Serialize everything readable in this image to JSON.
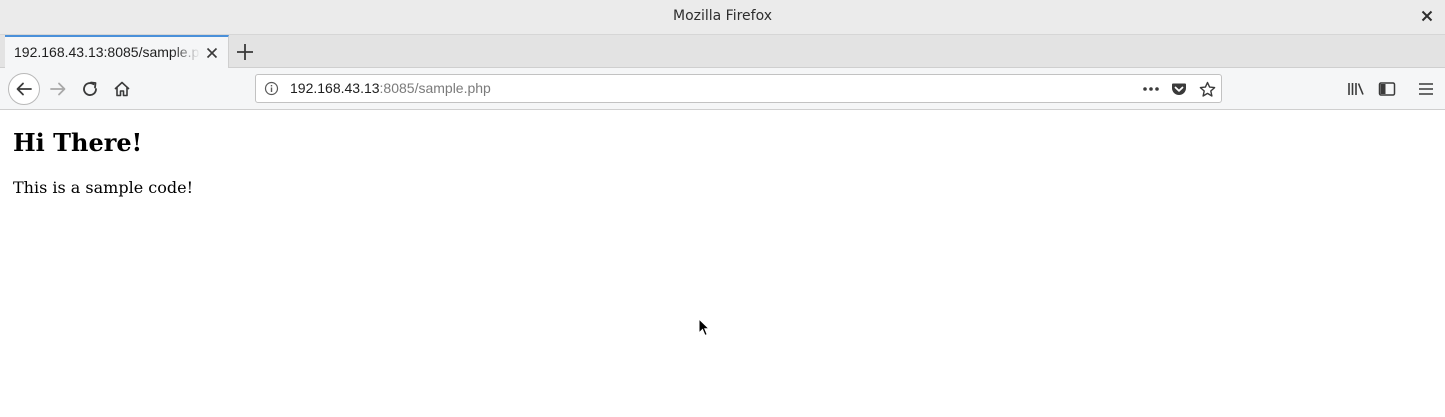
{
  "window": {
    "title": "Mozilla Firefox"
  },
  "tabs": [
    {
      "title": "192.168.43.13:8085/sample.php",
      "active": true
    }
  ],
  "urlbar": {
    "host": "192.168.43.13",
    "rest": ":8085/sample.php"
  },
  "page": {
    "heading": "Hi There!",
    "paragraph": "This is a sample code!"
  },
  "icons": {
    "window_close": "close-icon",
    "tab_close": "close-icon",
    "new_tab": "plus-icon",
    "back": "arrow-left-icon",
    "forward": "arrow-right-icon",
    "reload": "reload-icon",
    "home": "home-icon",
    "site_info": "info-icon",
    "page_actions": "ellipsis-icon",
    "pocket": "pocket-icon",
    "bookmark": "star-icon",
    "library": "library-icon",
    "sidebar": "sidebar-icon",
    "menu": "hamburger-icon"
  },
  "colors": {
    "active_tab_accent": "#4a90d9",
    "url_host": "#1e1e1e",
    "url_rest": "#7b7b7b"
  }
}
